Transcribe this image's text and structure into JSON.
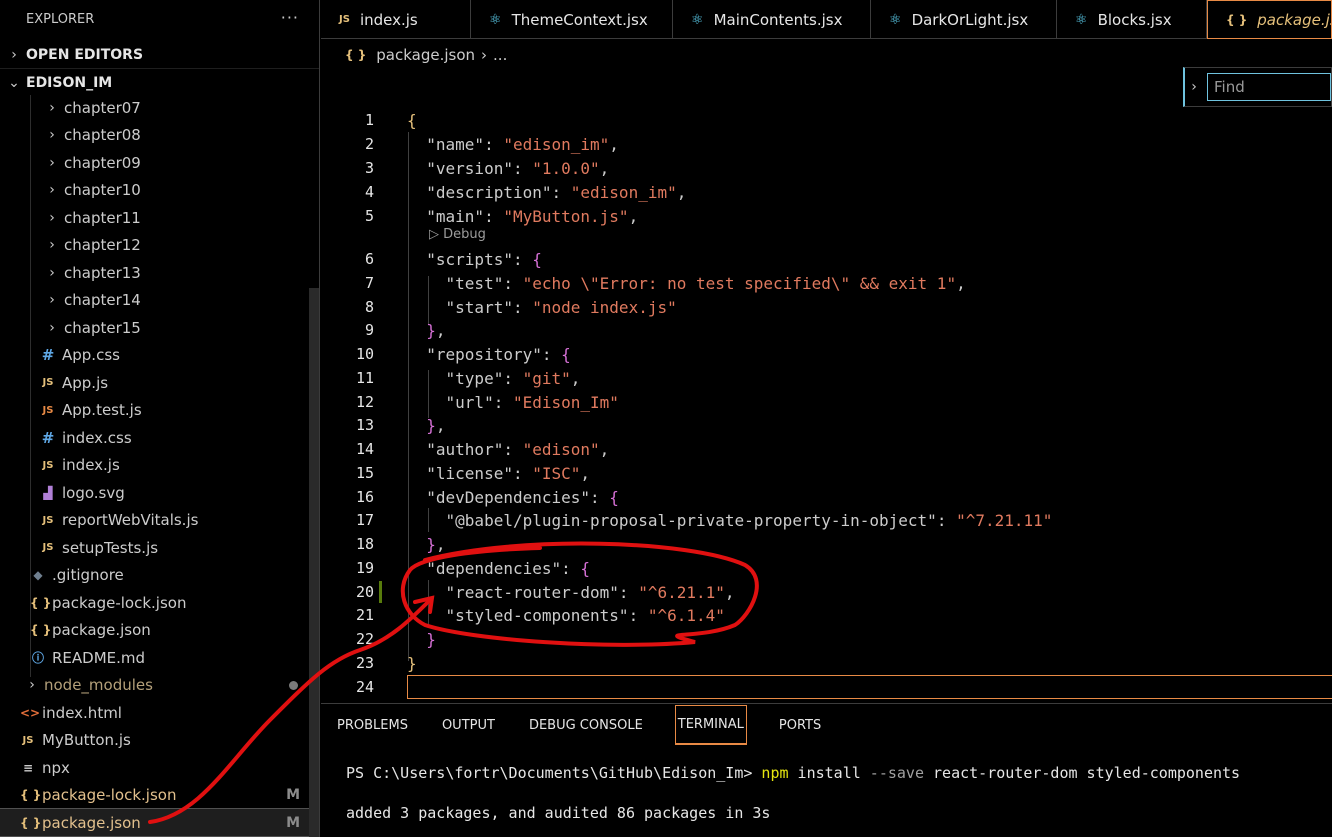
{
  "sidebar": {
    "title": "EXPLORER",
    "more_label": "···",
    "open_editors_label": "OPEN EDITORS",
    "root_label": "EDISON_IM",
    "tree": [
      {
        "label": "chapter07",
        "kind": "folder"
      },
      {
        "label": "chapter08",
        "kind": "folder"
      },
      {
        "label": "chapter09",
        "kind": "folder"
      },
      {
        "label": "chapter10",
        "kind": "folder"
      },
      {
        "label": "chapter11",
        "kind": "folder"
      },
      {
        "label": "chapter12",
        "kind": "folder"
      },
      {
        "label": "chapter13",
        "kind": "folder"
      },
      {
        "label": "chapter14",
        "kind": "folder"
      },
      {
        "label": "chapter15",
        "kind": "folder"
      },
      {
        "label": "App.css",
        "kind": "css"
      },
      {
        "label": "App.js",
        "kind": "js"
      },
      {
        "label": "App.test.js",
        "kind": "jstest"
      },
      {
        "label": "index.css",
        "kind": "css"
      },
      {
        "label": "index.js",
        "kind": "js"
      },
      {
        "label": "logo.svg",
        "kind": "svg"
      },
      {
        "label": "reportWebVitals.js",
        "kind": "js"
      },
      {
        "label": "setupTests.js",
        "kind": "js"
      },
      {
        "label": ".gitignore",
        "kind": "git"
      },
      {
        "label": "package-lock.json",
        "kind": "json"
      },
      {
        "label": "package.json",
        "kind": "json"
      },
      {
        "label": "README.md",
        "kind": "info"
      },
      {
        "label": "node_modules",
        "kind": "folder-root"
      },
      {
        "label": "index.html",
        "kind": "html"
      },
      {
        "label": "MyButton.js",
        "kind": "js"
      },
      {
        "label": "npx",
        "kind": "npx"
      },
      {
        "label": "package-lock.json",
        "kind": "json",
        "badge": "M"
      },
      {
        "label": "package.json",
        "kind": "json",
        "badge": "M"
      }
    ]
  },
  "icons": {
    "js": "JS",
    "css": "#",
    "json": "{ }",
    "svg": "svg-icon",
    "git": "diamond",
    "info": "ⓘ",
    "html": "<>",
    "npx": "≡"
  },
  "tabs": [
    {
      "label": "index.js",
      "icon": "JS"
    },
    {
      "label": "ThemeContext.jsx",
      "icon": "react"
    },
    {
      "label": "MainContents.jsx",
      "icon": "react"
    },
    {
      "label": "DarkOrLight.jsx",
      "icon": "react"
    },
    {
      "label": "Blocks.jsx",
      "icon": "react"
    },
    {
      "label": "package.json",
      "icon": "{ }",
      "active": true
    }
  ],
  "breadcrumb": {
    "file": "package.json",
    "rest": "..."
  },
  "find": {
    "placeholder": "Find"
  },
  "codelens": "Debug",
  "code": {
    "line_numbers": [
      "1",
      "2",
      "3",
      "4",
      "5",
      "6",
      "7",
      "8",
      "9",
      "10",
      "11",
      "12",
      "13",
      "14",
      "15",
      "16",
      "17",
      "18",
      "19",
      "20",
      "21",
      "22",
      "23",
      "24"
    ],
    "name": "\"edison_im\"",
    "version": "\"1.0.0\"",
    "description": "\"edison_im\"",
    "main": "\"MyButton.js\"",
    "test_value": "\"echo \\\"Error: no test specified\\\" && exit 1\"",
    "start_value": "\"node index.js\"",
    "repo_type": "\"git\"",
    "repo_url": "\"Edison_Im\"",
    "author": "\"edison\"",
    "license": "\"ISC\"",
    "babel_key": "\"@babel/plugin-proposal-private-property-in-object\"",
    "babel_value": "\"^7.21.11\"",
    "rrd_key": "\"react-router-dom\"",
    "rrd_value": "\"^6.21.1\"",
    "sc_key": "\"styled-components\"",
    "sc_value": "\"^6.1.4\""
  },
  "panel": {
    "tabs": [
      "PROBLEMS",
      "OUTPUT",
      "DEBUG CONSOLE",
      "TERMINAL",
      "PORTS"
    ],
    "active_tab": "TERMINAL",
    "prompt": "PS C:\\Users\\fortr\\Documents\\GitHub\\Edison_Im> ",
    "cmd": "npm",
    "cmd_rest1": " install ",
    "cmd_flag": "--save",
    "cmd_rest2": " react-router-dom styled-components",
    "output": "added 3 packages, and audited 86 packages in 3s"
  },
  "colors": {
    "annotation": "#e01010",
    "accent": "#e88a45",
    "string": "#e07a5f"
  }
}
